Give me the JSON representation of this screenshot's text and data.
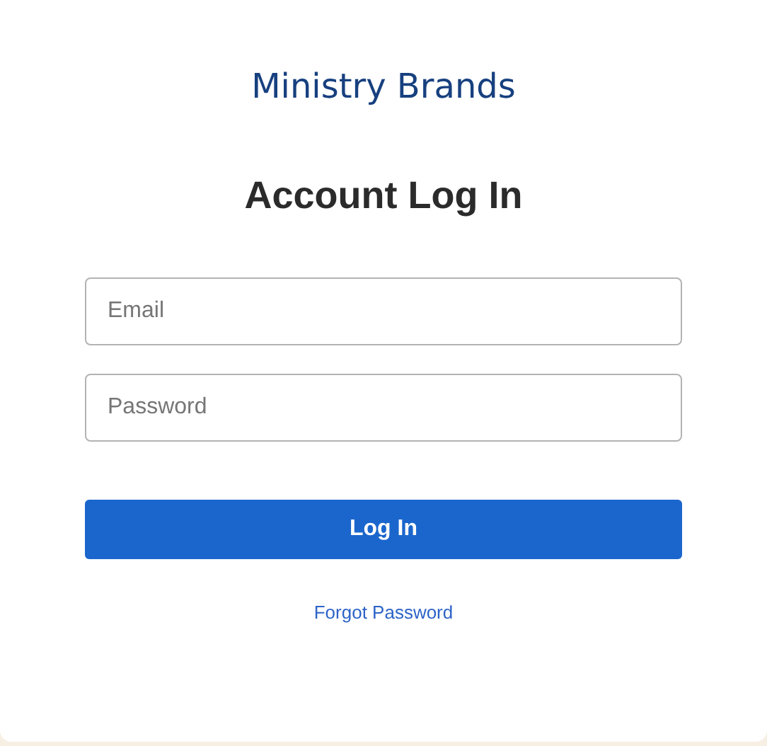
{
  "logo": {
    "text": "Ministry Brands"
  },
  "title": "Account Log In",
  "fields": [
    {
      "placeholder": "Email"
    },
    {
      "placeholder": "Password"
    }
  ],
  "submit_button": "Log In",
  "forgot_link": "Forgot Password"
}
